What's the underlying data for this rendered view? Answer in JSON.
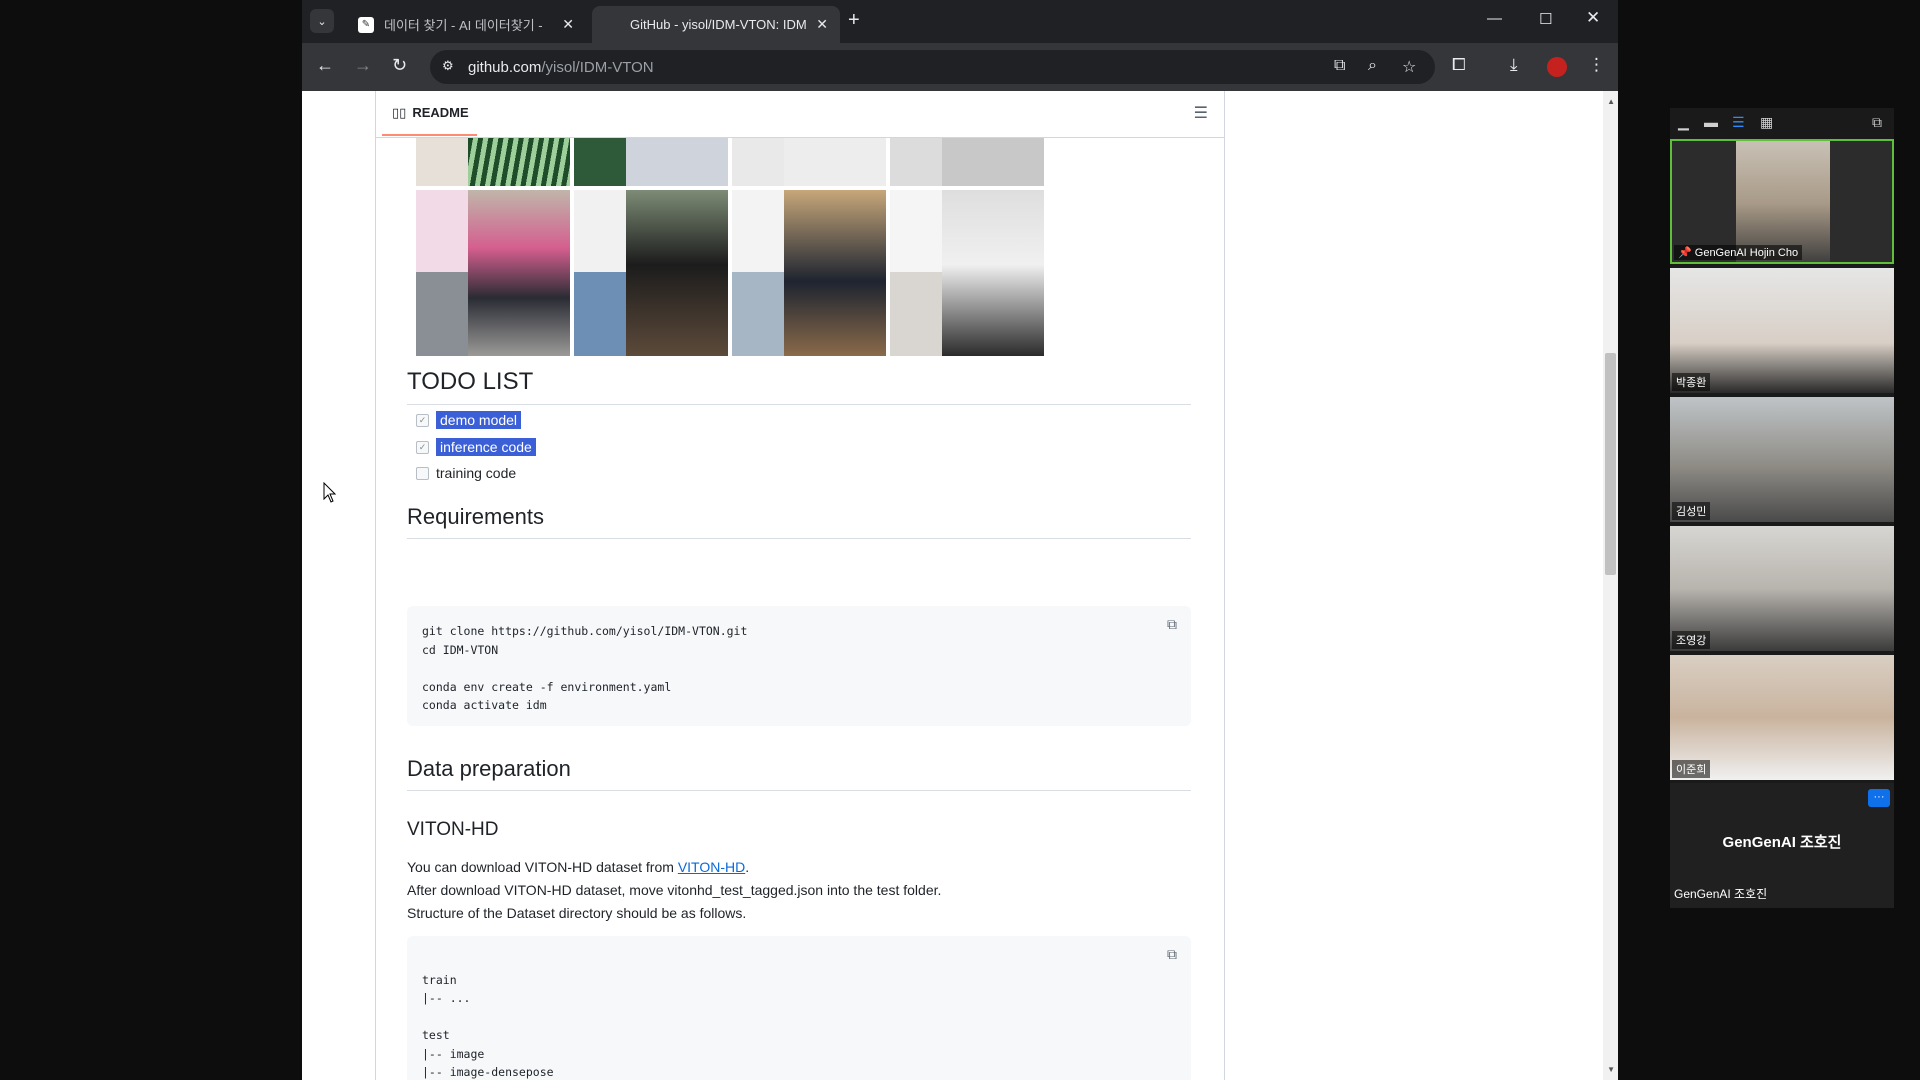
{
  "browser": {
    "tabs": [
      {
        "title": "데이터 찾기 - AI 데이터찾기 -",
        "active": false
      },
      {
        "title": "GitHub - yisol/IDM-VTON: IDM",
        "active": true
      }
    ],
    "url_domain": "github.com",
    "url_path": "/yisol/IDM-VTON"
  },
  "readme": {
    "tab_label": "README",
    "todo_heading": "TODO LIST",
    "todo_items": [
      {
        "label": "demo model",
        "checked": true,
        "selected": true
      },
      {
        "label": "inference code",
        "checked": true,
        "selected": true
      },
      {
        "label": "training code",
        "checked": false,
        "selected": false
      }
    ],
    "requirements_heading": "Requirements",
    "requirements_code": "git clone https://github.com/yisol/IDM-VTON.git\ncd IDM-VTON\n\nconda env create -f environment.yaml\nconda activate idm",
    "data_prep_heading": "Data preparation",
    "viton_heading": "VITON-HD",
    "viton_p1_prefix": "You can download VITON-HD dataset from ",
    "viton_p1_link": "VITON-HD",
    "viton_p1_suffix": ".",
    "viton_p2": "After download VITON-HD dataset, move vitonhd_test_tagged.json into the test folder.",
    "viton_p3": "Structure of the Dataset directory should be as follows.",
    "structure_code": "\ntrain\n|-- ...\n\ntest\n|-- image\n|-- image-densepose"
  },
  "meeting": {
    "participants": [
      {
        "name": "GenGenAI Hojin Cho",
        "pinned": true
      },
      {
        "name": "박종환"
      },
      {
        "name": "김성민"
      },
      {
        "name": "조영강"
      },
      {
        "name": "이준희"
      }
    ],
    "audio_only_display": "GenGenAI 조호진",
    "audio_only_label": "GenGenAI 조호진"
  },
  "colors": {
    "selection": "#3b5fd6",
    "link": "#0969da",
    "active_speaker": "#5fbf3b"
  }
}
